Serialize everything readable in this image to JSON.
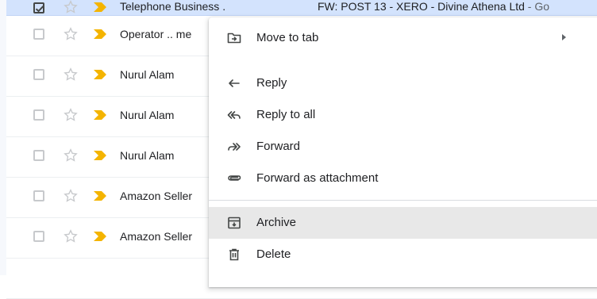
{
  "rows": [
    {
      "sender": "Telephone Business .",
      "subject": "FW: POST 13 - XERO - Divine Athena Ltd",
      "subject_tail": " - Go",
      "checked": true
    },
    {
      "sender": "Operator .. me",
      "checked": false
    },
    {
      "sender": "Nurul Alam",
      "checked": false
    },
    {
      "sender": "Nurul Alam",
      "checked": false
    },
    {
      "sender": "Nurul Alam",
      "checked": false
    },
    {
      "sender": "Amazon Seller",
      "checked": false
    },
    {
      "sender": "Amazon Seller",
      "checked": false
    }
  ],
  "context_menu": {
    "move_to_tab": {
      "label": "Move to tab",
      "icon": "move-to-tab-icon"
    },
    "reply": {
      "label": "Reply",
      "icon": "reply-icon"
    },
    "reply_all": {
      "label": "Reply to all",
      "icon": "reply-all-icon"
    },
    "forward": {
      "label": "Forward",
      "icon": "forward-icon"
    },
    "forward_attachment": {
      "label": "Forward as attachment",
      "icon": "attachment-icon"
    },
    "archive": {
      "label": "Archive",
      "icon": "archive-icon"
    },
    "delete": {
      "label": "Delete",
      "icon": "delete-icon"
    }
  },
  "colors": {
    "selected_row": "#d3e3fd",
    "importance_marker": "#f4b400",
    "menu_hover": "#e8e8e8"
  }
}
